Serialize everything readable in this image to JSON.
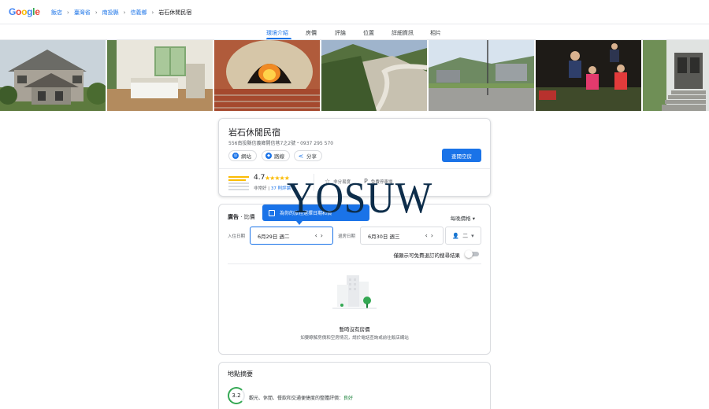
{
  "brand": {
    "letters": [
      "G",
      "o",
      "o",
      "g",
      "l",
      "e"
    ],
    "colors": [
      "#4285f4",
      "#ea4335",
      "#fbbc05",
      "#4285f4",
      "#34a853",
      "#ea4335"
    ]
  },
  "breadcrumbs": [
    "飯店",
    "臺灣省",
    "南投縣",
    "信義鄉",
    "岩石休閒民宿"
  ],
  "tabs": [
    "環境介紹",
    "房價",
    "評論",
    "位置",
    "詳細資訊",
    "相片"
  ],
  "hotel": {
    "name": "岩石休閒民宿",
    "address": "556南投縣信義鄉開信巷7之2號・0937 295 570",
    "actions": {
      "website": "網站",
      "directions": "路線",
      "share": "分享"
    },
    "book_label": "查閱空房",
    "rating": "4.7",
    "stars": "★★★★★",
    "rating_desc": "非常好",
    "reviews_link": "37 則評論",
    "features": [
      "非分易度",
      "免費停車場"
    ]
  },
  "availability": {
    "ad_label": "廣告",
    "compare_label": "比價",
    "tooltip": "為你的旅程選擇日期和價",
    "price_option": "每晚價格",
    "checkin_label": "入住日期",
    "checkin_value": "6月29日 週二",
    "checkout_label": "退房日期",
    "checkout_value": "6月30日 週三",
    "guests": "二",
    "toggle_label": "僅顯示可免費退訂的搜尋結果",
    "empty_title": "暫時沒有房價",
    "empty_sub": "如要瞭解房價和空房情況，請於電話查詢或前往飯店網站"
  },
  "location": {
    "title": "地點摘要",
    "score": "3.2",
    "summary_prefix": "觀光、休閒、餐飲和交通便捷度的整體評價：",
    "summary_rating": "良好"
  },
  "watermark": "YOSUW"
}
